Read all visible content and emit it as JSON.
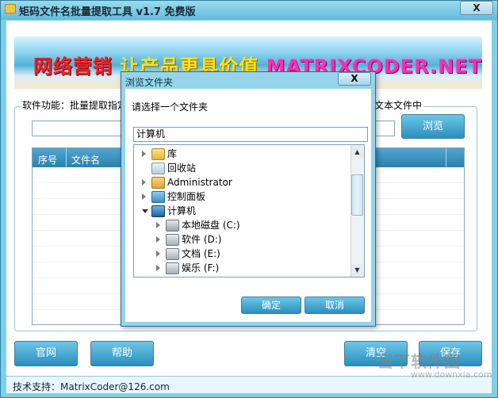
{
  "window": {
    "title": "矩码文件名批量提取工具 v1.7 免费版",
    "close_label": "X"
  },
  "banner": {
    "part1": "网络营销",
    "part2": "让产品更具价值",
    "part3": "MATRIXCODER.NET"
  },
  "main": {
    "feature_label": "软件功能：批量提取指定",
    "feature_label_tail": "文本文件中",
    "browse_label": "浏览",
    "list_columns": [
      "序号",
      "文件名"
    ]
  },
  "buttons": {
    "site": "官网",
    "help": "帮助",
    "clear": "清空",
    "save": "保存"
  },
  "status": {
    "support": "技术支持：MatrixCoder@126.com"
  },
  "watermark": {
    "text": "当下软件园",
    "url": "www.downxia.com"
  },
  "dialog": {
    "title": "浏览文件夹",
    "close_label": "X",
    "prompt": "请选择一个文件夹",
    "selected_folder": "计算机",
    "tree": [
      {
        "label": "库",
        "icon": "library-folder-icon",
        "expand": "collapsed",
        "indent": 0
      },
      {
        "label": "回收站",
        "icon": "recycle-bin-icon",
        "expand": "none",
        "indent": 0
      },
      {
        "label": "Administrator",
        "icon": "user-folder-icon",
        "expand": "collapsed",
        "indent": 0
      },
      {
        "label": "控制面板",
        "icon": "control-panel-icon",
        "expand": "collapsed",
        "indent": 0
      },
      {
        "label": "计算机",
        "icon": "computer-icon",
        "expand": "expanded",
        "indent": 0
      },
      {
        "label": "本地磁盘 (C:)",
        "icon": "system-drive-icon",
        "expand": "collapsed",
        "indent": 1
      },
      {
        "label": "软件 (D:)",
        "icon": "drive-icon",
        "expand": "collapsed",
        "indent": 1
      },
      {
        "label": "文档 (E:)",
        "icon": "drive-icon",
        "expand": "collapsed",
        "indent": 1
      },
      {
        "label": "娱乐 (F:)",
        "icon": "drive-icon",
        "expand": "collapsed",
        "indent": 1
      }
    ],
    "ok_label": "确定",
    "cancel_label": "取消"
  },
  "colors": {
    "accent": "#2a8fbd",
    "frame": "#7fd0e6"
  }
}
